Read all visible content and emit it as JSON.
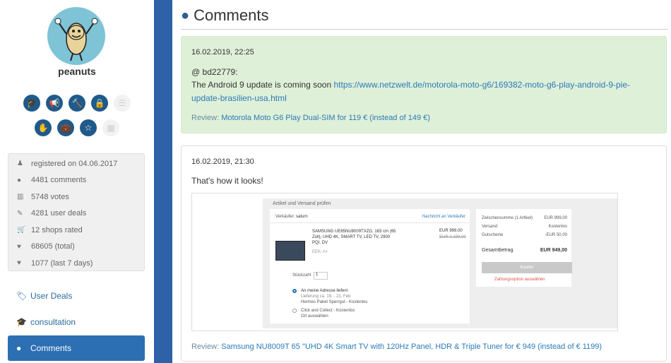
{
  "user": {
    "name": "peanuts",
    "badges_row1": [
      {
        "icon": "graduation-cap-icon",
        "glyph": "🎓",
        "active": true
      },
      {
        "icon": "bullhorn-icon",
        "glyph": "📢",
        "active": true
      },
      {
        "icon": "gavel-icon",
        "glyph": "🔨",
        "active": true
      },
      {
        "icon": "lock-icon",
        "glyph": "🔒",
        "active": true
      },
      {
        "icon": "list-icon",
        "glyph": "☰",
        "active": false
      }
    ],
    "badges_row2": [
      {
        "icon": "hand-icon",
        "glyph": "✋",
        "active": true
      },
      {
        "icon": "suitcase-icon",
        "glyph": "💼",
        "active": true
      },
      {
        "icon": "star-icon",
        "glyph": "☆",
        "active": true
      },
      {
        "icon": "building-icon",
        "glyph": "▦",
        "active": false
      }
    ],
    "stats": [
      {
        "icon": "user-icon",
        "glyph": "♟",
        "text": "registered on 04.06.2017"
      },
      {
        "icon": "comment-icon",
        "glyph": "●",
        "text": "4481 comments"
      },
      {
        "icon": "bar-chart-icon",
        "glyph": "▥",
        "text": "5748 votes"
      },
      {
        "icon": "pencil-icon",
        "glyph": "✎",
        "text": "4281 user deals"
      },
      {
        "icon": "cart-icon",
        "glyph": "🛒",
        "text": "12 shops rated"
      },
      {
        "icon": "heartbeat-icon",
        "glyph": "♥",
        "text": "68605 (total)"
      },
      {
        "icon": "heartbeat-icon",
        "glyph": "♥",
        "text": "1077 (last 7 days)"
      }
    ]
  },
  "nav": {
    "user_deals": "User Deals",
    "consultation": "consultation",
    "comments": "Comments"
  },
  "page": {
    "title": "Comments"
  },
  "comments": [
    {
      "timestamp": "16.02.2019, 22:25",
      "mention": "@ bd22779:",
      "text": "The Android 9 update is coming soon",
      "link": "https://www.netzwelt.de/motorola-moto-g6/169382-moto-g6-play-android-9-pie-update-brasilien-usa.html",
      "review_prefix": "Review:",
      "review_link": "Motorola Moto G6 Play Dual-SIM for 119 € (instead of 149 €)"
    },
    {
      "timestamp": "16.02.2019, 21:30",
      "text": "That's how it looks!",
      "review_prefix": "Review:",
      "review_link": "Samsung NU8009T 65 \"UHD 4K Smart TV with 120Hz Panel, HDR & Triple Tuner for € 949 (instead of € 1199)"
    }
  ],
  "embedded_screenshot": {
    "title": "Artikel und Versand prüfen",
    "seller_label": "Verkäufer:",
    "seller": "saturn",
    "seller_link": "Nachricht an Verkäufer",
    "product": "SAMSUNG UE65NU8009TXZG, 163 cm (65 Zoll), UHD 4K, SMART TV, LED TV, 2900 PQI, DV",
    "energy": "EEK: A+",
    "price": "EUR 999,00",
    "old_price": "EUR 1.199,00",
    "qty_label": "Stückzahl",
    "qty": "1",
    "ship_option1": "An meine Adresse liefern",
    "ship_option1_detail1": "Lieferung ca. 19. - 21. Feb",
    "ship_option1_detail2": "Hermes Paket Sperrgut - Kostenlos",
    "ship_option2": "Click and Collect - Kostenlos",
    "ship_option2_detail": "Ort auswählen",
    "subtotal_label": "Zwischensumme (1 Artikel)",
    "subtotal": "EUR 999,00",
    "shipping_label": "Versand",
    "shipping": "Kostenlos",
    "voucher_label": "Gutscheine",
    "voucher": "-EUR 50,00",
    "total_label": "Gesamtbetrag",
    "total": "EUR 949,00",
    "buy_label": "Kaufen",
    "payment_note": "Zahlungsoption auswählen"
  },
  "colors": {
    "accent": "#2d62a8",
    "green_card": "#dff0d8",
    "link": "#2a7ab8"
  }
}
